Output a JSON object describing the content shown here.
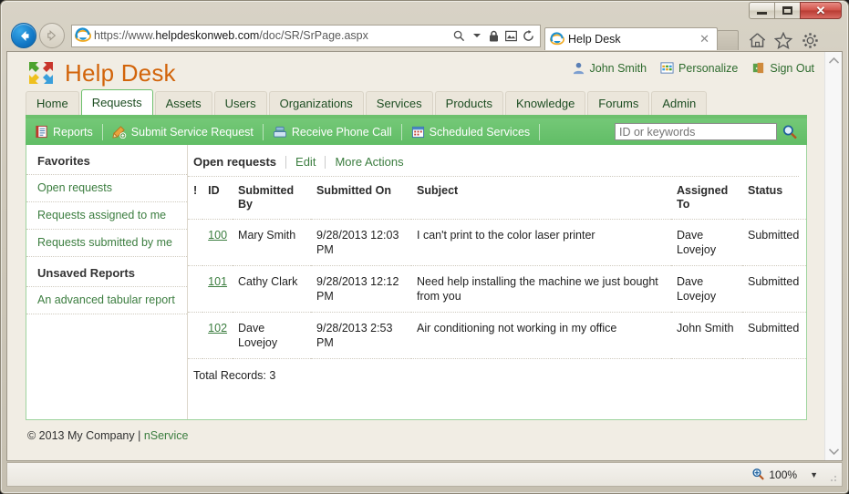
{
  "browser": {
    "url_prefix": "https://www.",
    "url_domain": "helpdeskonweb.com",
    "url_path": "/doc/SR/SrPage.aspx",
    "tab_title": "Help Desk",
    "tab_close": "✕",
    "window_minimize": "minimize-button",
    "window_maximize": "maximize-button",
    "window_close": "✕",
    "status_zoom": "100%",
    "zoom_caret": "▼"
  },
  "header": {
    "app_title": "Help Desk",
    "user_name": "John Smith",
    "personalize": "Personalize",
    "sign_out": "Sign Out"
  },
  "main_tabs": [
    {
      "label": "Home",
      "active": false
    },
    {
      "label": "Requests",
      "active": true
    },
    {
      "label": "Assets",
      "active": false
    },
    {
      "label": "Users",
      "active": false
    },
    {
      "label": "Organizations",
      "active": false
    },
    {
      "label": "Services",
      "active": false
    },
    {
      "label": "Products",
      "active": false
    },
    {
      "label": "Knowledge",
      "active": false
    },
    {
      "label": "Forums",
      "active": false
    },
    {
      "label": "Admin",
      "active": false
    }
  ],
  "toolbar": {
    "items": [
      {
        "label": "Reports",
        "icon": "report-icon"
      },
      {
        "label": "Submit Service Request",
        "icon": "submit-request-icon"
      },
      {
        "label": "Receive Phone Call",
        "icon": "phone-icon"
      },
      {
        "label": "Scheduled Services",
        "icon": "calendar-icon"
      }
    ],
    "search_placeholder": "ID or keywords",
    "search_value": ""
  },
  "sidebar": {
    "groups": [
      {
        "title": "Favorites",
        "links": [
          "Open requests",
          "Requests assigned to me",
          "Requests submitted by me"
        ]
      },
      {
        "title": "Unsaved Reports",
        "links": [
          "An advanced tabular report"
        ]
      }
    ]
  },
  "content": {
    "view_title": "Open requests",
    "action_edit": "Edit",
    "action_more": "More Actions",
    "columns": [
      "!",
      "ID",
      "Submitted By",
      "Submitted On",
      "Subject",
      "Assigned To",
      "Status"
    ],
    "rows": [
      {
        "flag": "",
        "id": "100",
        "submitted_by": "Mary Smith",
        "submitted_on": "9/28/2013 12:03 PM",
        "subject": "I can't print to the color laser printer",
        "assigned_to": "Dave Lovejoy",
        "status": "Submitted"
      },
      {
        "flag": "",
        "id": "101",
        "submitted_by": "Cathy Clark",
        "submitted_on": "9/28/2013 12:12 PM",
        "subject": "Need help installing the machine we just bought from you",
        "assigned_to": "Dave Lovejoy",
        "status": "Submitted"
      },
      {
        "flag": "",
        "id": "102",
        "submitted_by": "Dave Lovejoy",
        "submitted_on": "9/28/2013 2:53 PM",
        "subject": "Air conditioning not working in my office",
        "assigned_to": "John Smith",
        "status": "Submitted"
      }
    ],
    "total_records": "Total Records: 3"
  },
  "footer": {
    "copyright": "© 2013 My Company |",
    "product": "nService"
  },
  "colors": {
    "brand_orange": "#d2640a",
    "accent_green": "#6dc06d",
    "link_green": "#3b7d3f"
  }
}
